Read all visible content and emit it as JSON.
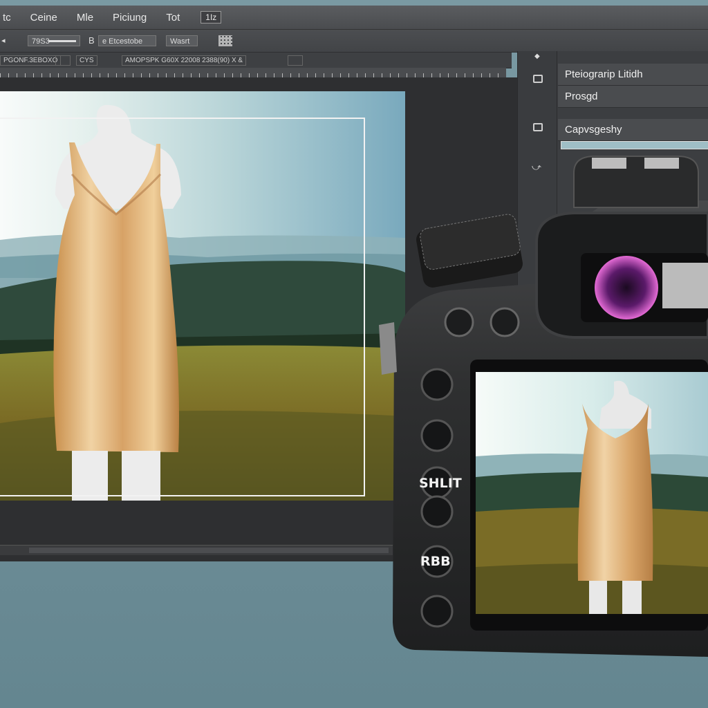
{
  "menu": {
    "items": [
      "tc",
      "Ceine",
      "Mle",
      "Piciung",
      "Tot"
    ],
    "badge": "1Iz"
  },
  "options": {
    "field1": "79S3",
    "field2": "B",
    "field3": "e Etcestobe",
    "field4": "Wasrt"
  },
  "tabs": {
    "tab1": "PGONF.3EBOXO",
    "tab2": "CYS",
    "tab3": "AMOPSPK G60X 22008 2388(90) X &"
  },
  "panel": {
    "title": "Pteiograrip Litidh",
    "row2": "Prosgd",
    "row3": "Capvsgeshy"
  },
  "camera": {
    "button_shift_label": "SHLIT",
    "button_rbb_label": "RBB"
  },
  "colors": {
    "ui_dark": "#2e2f31",
    "panel_bg": "#3c3e41",
    "camera_body": "#2a2b2c",
    "dress_satin": "#d9a86a",
    "sky": "#79a9bd"
  }
}
